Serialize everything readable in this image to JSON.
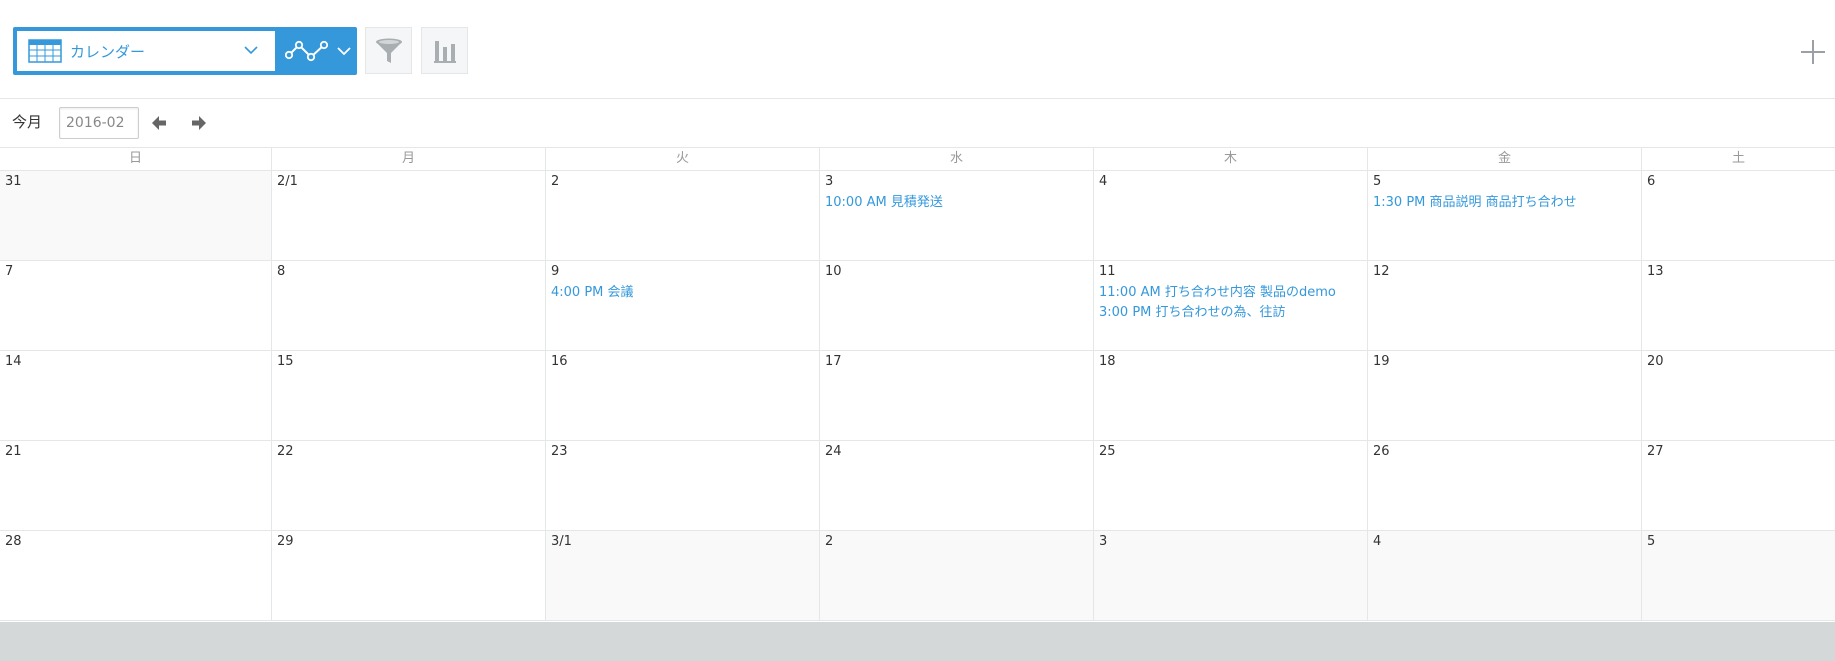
{
  "toolbar": {
    "view_label": "カレンダー",
    "view_icon": "table-icon",
    "graph_icon": "graph-icon",
    "filter_icon": "filter-icon",
    "chart_icon": "bar-chart-icon",
    "add_icon": "plus-icon",
    "accent_color": "#3498db"
  },
  "nav": {
    "today_label": "今月",
    "month_value": "2016-02",
    "prev_icon": "arrow-left-icon",
    "next_icon": "arrow-right-icon"
  },
  "calendar": {
    "weekdays": [
      "日",
      "月",
      "火",
      "水",
      "木",
      "金",
      "土"
    ],
    "weeks": [
      {
        "days": [
          {
            "label": "31",
            "other": true,
            "events": []
          },
          {
            "label": "2/1",
            "other": false,
            "events": []
          },
          {
            "label": "2",
            "other": false,
            "events": []
          },
          {
            "label": "3",
            "other": false,
            "events": [
              "10:00 AM 見積発送"
            ]
          },
          {
            "label": "4",
            "other": false,
            "events": []
          },
          {
            "label": "5",
            "other": false,
            "events": [
              "1:30 PM 商品説明 商品打ち合わせ"
            ]
          },
          {
            "label": "6",
            "other": false,
            "events": []
          }
        ]
      },
      {
        "days": [
          {
            "label": "7",
            "other": false,
            "events": []
          },
          {
            "label": "8",
            "other": false,
            "events": []
          },
          {
            "label": "9",
            "other": false,
            "events": [
              "4:00 PM 会議"
            ]
          },
          {
            "label": "10",
            "other": false,
            "events": []
          },
          {
            "label": "11",
            "other": false,
            "events": [
              "11:00 AM 打ち合わせ内容 製品のdemo",
              "3:00 PM 打ち合わせの為、往訪"
            ]
          },
          {
            "label": "12",
            "other": false,
            "events": []
          },
          {
            "label": "13",
            "other": false,
            "events": []
          }
        ]
      },
      {
        "days": [
          {
            "label": "14",
            "other": false,
            "events": []
          },
          {
            "label": "15",
            "other": false,
            "events": []
          },
          {
            "label": "16",
            "other": false,
            "events": []
          },
          {
            "label": "17",
            "other": false,
            "events": []
          },
          {
            "label": "18",
            "other": false,
            "events": []
          },
          {
            "label": "19",
            "other": false,
            "events": []
          },
          {
            "label": "20",
            "other": false,
            "events": []
          }
        ]
      },
      {
        "days": [
          {
            "label": "21",
            "other": false,
            "events": []
          },
          {
            "label": "22",
            "other": false,
            "events": []
          },
          {
            "label": "23",
            "other": false,
            "events": []
          },
          {
            "label": "24",
            "other": false,
            "events": []
          },
          {
            "label": "25",
            "other": false,
            "events": []
          },
          {
            "label": "26",
            "other": false,
            "events": []
          },
          {
            "label": "27",
            "other": false,
            "events": []
          }
        ]
      },
      {
        "days": [
          {
            "label": "28",
            "other": false,
            "events": []
          },
          {
            "label": "29",
            "other": false,
            "events": []
          },
          {
            "label": "3/1",
            "other": true,
            "events": []
          },
          {
            "label": "2",
            "other": true,
            "events": []
          },
          {
            "label": "3",
            "other": true,
            "events": []
          },
          {
            "label": "4",
            "other": true,
            "events": []
          },
          {
            "label": "5",
            "other": true,
            "events": []
          }
        ]
      }
    ]
  }
}
